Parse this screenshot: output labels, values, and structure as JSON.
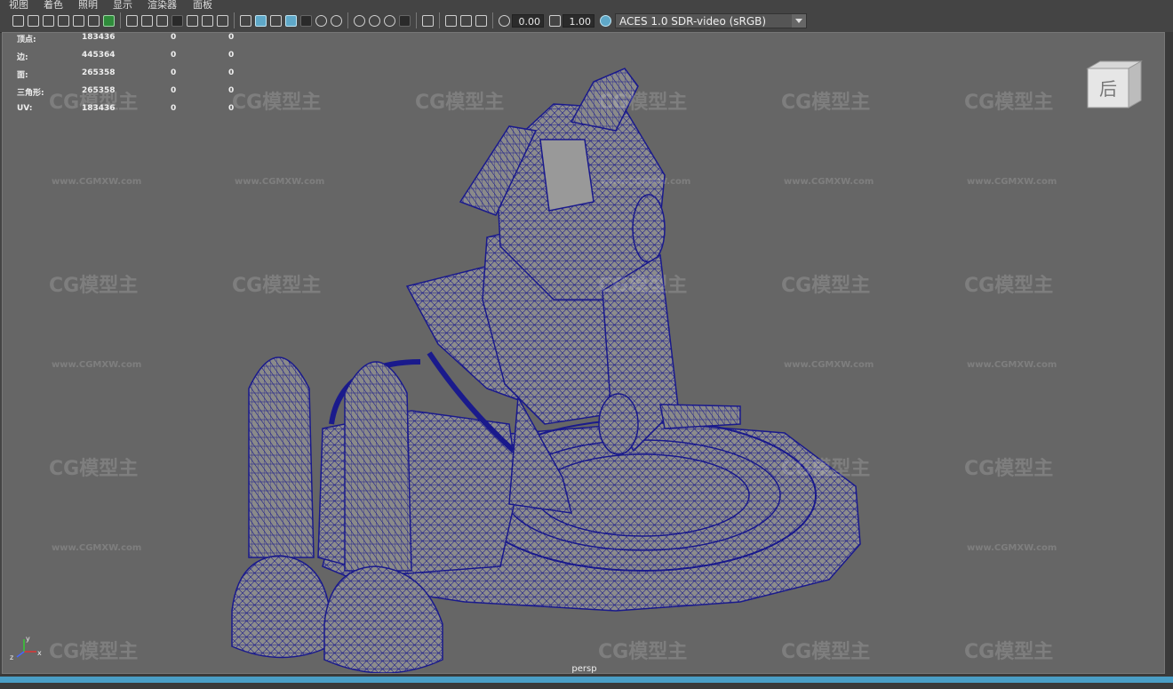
{
  "menu": {
    "items": [
      "视图",
      "着色",
      "照明",
      "显示",
      "渲染器",
      "面板"
    ]
  },
  "toolbar": {
    "exposure_value": "0.00",
    "gamma_value": "1.00",
    "color_management_label": "ACES 1.0 SDR-video (sRGB)"
  },
  "hud": {
    "rows": [
      {
        "label": "顶点:",
        "total": "183436",
        "selected": "0",
        "components": "0"
      },
      {
        "label": "边:",
        "total": "445364",
        "selected": "0",
        "components": "0"
      },
      {
        "label": "面:",
        "total": "265358",
        "selected": "0",
        "components": "0"
      },
      {
        "label": "三角形:",
        "total": "265358",
        "selected": "0",
        "components": "0"
      },
      {
        "label": "UV:",
        "total": "183436",
        "selected": "0",
        "components": "0"
      }
    ]
  },
  "viewport": {
    "camera_label": "persp",
    "viewcube_face": "后",
    "axis_x": "x",
    "axis_y": "y",
    "axis_z": "z"
  },
  "watermark": {
    "logo": "CG模型主",
    "url": "www.CGMXW.com"
  },
  "colors": {
    "ui_bg": "#444444",
    "viewport_bg": "#666666",
    "wireframe": "#1a1a8c",
    "accent_blue": "#4a9ec6"
  }
}
